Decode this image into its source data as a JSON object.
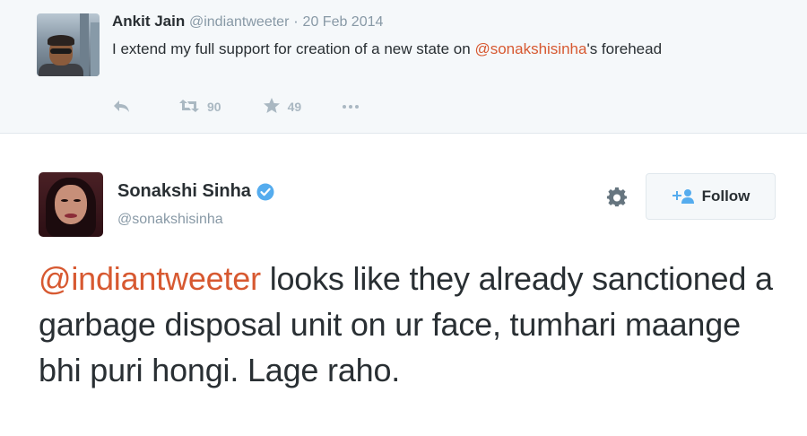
{
  "parent_tweet": {
    "author_name": "Ankit Jain",
    "author_handle": "@indiantweeter",
    "separator": "·",
    "date": "20 Feb 2014",
    "text_before": "I extend my full support for creation of a new state on ",
    "mention": "@sonakshisinha",
    "text_after": "'s forehead",
    "retweet_count": "90",
    "favorite_count": "49"
  },
  "main_tweet": {
    "author_name": "Sonakshi Sinha",
    "author_handle": "@sonakshisinha",
    "follow_label": "Follow",
    "mention": "@indiantweeter",
    "text": " looks like they already sanctioned a garbage disposal unit on ur face, tumhari maange bhi puri hongi. Lage raho."
  },
  "colors": {
    "mention": "#d75931",
    "verified": "#55acee",
    "icon_gray": "#aab8c2",
    "parent_bg": "#f5f8fa"
  },
  "icons": [
    "reply-icon",
    "retweet-icon",
    "favorite-icon",
    "more-icon",
    "verified-icon",
    "gear-icon",
    "follow-person-icon"
  ]
}
